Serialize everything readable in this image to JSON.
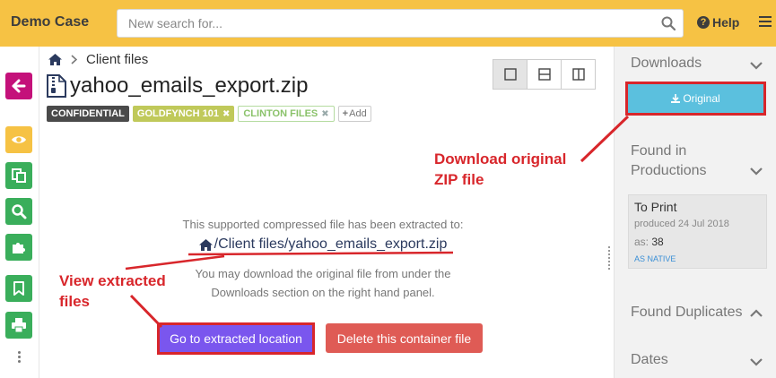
{
  "header": {
    "app_title": "Demo Case",
    "search_placeholder": "New search for...",
    "help_label": "Help"
  },
  "breadcrumb": {
    "items": [
      "Client files"
    ]
  },
  "document": {
    "filename": "yahoo_emails_export.zip"
  },
  "tags": [
    {
      "label": "CONFIDENTIAL",
      "color": "#4a4a4a"
    },
    {
      "label": "GOLDFYNCH 101",
      "color": "#c0c95a"
    },
    {
      "label": "CLINTON FILES",
      "color": "#8ac26a"
    }
  ],
  "add_tag_label": "Add",
  "main": {
    "extracted_message": "This supported compressed file has been extracted to:",
    "extracted_path": "/Client files/yahoo_emails_export.zip",
    "download_hint_line1": "You may download the original file from under the",
    "download_hint_line2": "Downloads section on the right hand panel.",
    "go_button": "Go to extracted location",
    "delete_button": "Delete this container file"
  },
  "right_panel": {
    "downloads_title": "Downloads",
    "original_button": "Original",
    "found_in_productions_line1": "Found in",
    "found_in_productions_line2": "Productions",
    "production": {
      "title": "To Print",
      "produced": "produced 24 Jul 2018",
      "as_label": "as:",
      "as_value": "38",
      "native_label": "AS NATIVE"
    },
    "found_duplicates_title": "Found Duplicates",
    "dates_title": "Dates"
  },
  "annotations": {
    "download_original_line1": "Download original",
    "download_original_line2": "ZIP file",
    "view_extracted_line1": "View extracted",
    "view_extracted_line2": "files"
  },
  "colors": {
    "topbar": "#f6c244",
    "back_button": "#c4117a",
    "sidebar_eye": "#f6c244",
    "sidebar_green": "#3aae5b",
    "primary_purple": "#7a56ee",
    "danger_red": "#df5b55",
    "info_blue": "#5bc0de",
    "annotation_red": "#d8262b"
  }
}
